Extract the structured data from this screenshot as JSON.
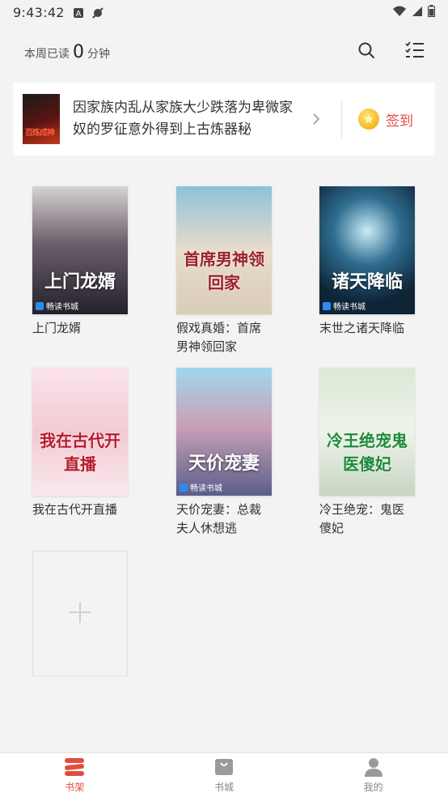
{
  "status_bar": {
    "time": "9:43:42",
    "left_icons": [
      "a-notification-icon",
      "no-sound-icon"
    ],
    "right_icons": [
      "wifi-icon",
      "signal-icon",
      "battery-icon"
    ]
  },
  "header": {
    "weekly_prefix": "本周已读",
    "weekly_minutes": "0",
    "weekly_unit": "分钟",
    "search_icon": "search-icon",
    "manage_icon": "checklist-icon"
  },
  "recommendation": {
    "text": "因家族内乱从家族大少跌落为卑微家奴的罗征意外得到上古炼器秘",
    "cover_glyph": "百炼成神",
    "arrow_icon": "chevron-right-icon",
    "checkin_label": "签到",
    "checkin_icon": "gold-coin-icon"
  },
  "books": [
    {
      "title": "上门龙婿",
      "cover_text": "上门龙婿",
      "badge": "畅读书城"
    },
    {
      "title": "假戏真婚：首席男神领回家",
      "cover_text": "首席男神领回家",
      "badge": ""
    },
    {
      "title": "末世之诸天降临",
      "cover_text": "诸天降临",
      "badge": "畅读书城"
    },
    {
      "title": "我在古代开直播",
      "cover_text": "我在古代开直播",
      "badge": ""
    },
    {
      "title": "天价宠妻：总裁夫人休想逃",
      "cover_text": "天价宠妻",
      "badge": "畅读书城"
    },
    {
      "title": "冷王绝宠：鬼医傻妃",
      "cover_text": "冷王绝宠鬼医傻妃",
      "badge": ""
    }
  ],
  "add_tile": {
    "icon": "plus-icon"
  },
  "bottom_nav": [
    {
      "label": "书架",
      "icon": "bookshelf-icon",
      "active": true
    },
    {
      "label": "书城",
      "icon": "bookstore-icon",
      "active": false
    },
    {
      "label": "我的",
      "icon": "profile-icon",
      "active": false
    }
  ],
  "colors": {
    "accent": "#e24c3f",
    "background": "#f3f3f3",
    "card": "#ffffff",
    "inactive_nav": "#888888",
    "coin": "#f5b81c"
  }
}
